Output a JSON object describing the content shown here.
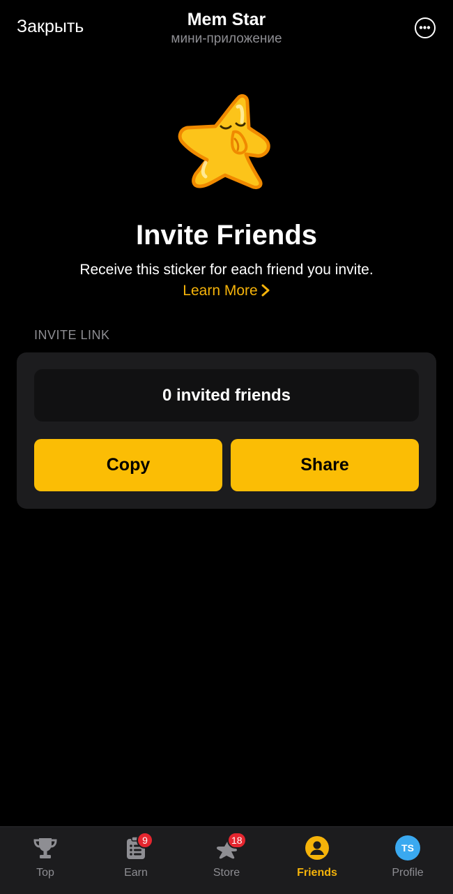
{
  "header": {
    "close_label": "Закрыть",
    "title": "Mem Star",
    "subtitle": "мини-приложение",
    "menu_icon": "more-horizontal-icon"
  },
  "sticker": {
    "icon": "star-sticker-icon",
    "colors": {
      "fill": "#fcc41a",
      "outline": "#f08a00"
    }
  },
  "hero": {
    "heading": "Invite Friends",
    "description": "Receive this sticker for each friend you invite.",
    "learn_more": "Learn More"
  },
  "invite": {
    "section_label": "INVITE LINK",
    "count_text": "0 invited friends",
    "copy_label": "Copy",
    "share_label": "Share"
  },
  "tabbar": {
    "tabs": [
      {
        "label": "Top",
        "icon": "trophy-icon"
      },
      {
        "label": "Earn",
        "icon": "clipboard-icon",
        "badge": "9"
      },
      {
        "label": "Store",
        "icon": "star-icon",
        "badge": "18"
      },
      {
        "label": "Friends",
        "icon": "person-icon",
        "active": true
      },
      {
        "label": "Profile",
        "icon": "avatar",
        "avatar_initials": "TS"
      }
    ]
  },
  "colors": {
    "background": "#000000",
    "card": "#1c1c1e",
    "accent": "#fbbd05",
    "link": "#f5b30a",
    "muted": "#8e8e93",
    "badge": "#e5262f",
    "avatar": "#3aa9f0"
  }
}
